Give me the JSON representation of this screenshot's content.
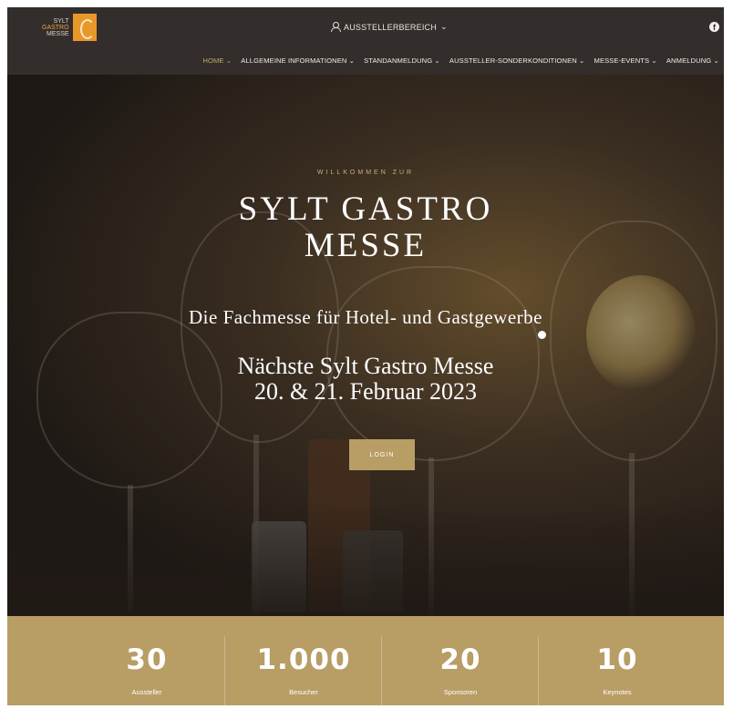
{
  "header": {
    "logo": {
      "line1": "SYLT",
      "line2": "GASTRO",
      "line3": "MESSE",
      "accent": "#e8972b"
    },
    "aussteller_link": "AUSSTELLERBEREICH",
    "social_icon": "facebook-icon"
  },
  "nav": {
    "items": [
      {
        "label": "HOME ⌄",
        "active": true
      },
      {
        "label": "ALLGEMEINE INFORMATIONEN ⌄"
      },
      {
        "label": "STANDANMELDUNG ⌄"
      },
      {
        "label": "AUSSTELLER-SONDERKONDITIONEN ⌄"
      },
      {
        "label": "MESSE-EVENTS ⌄"
      },
      {
        "label": "ANMELDUNG ⌄"
      }
    ]
  },
  "hero": {
    "welcome": "WILLKOMMEN ZUR",
    "title_line1": "SYLT GASTRO",
    "title_line2": "MESSE",
    "subtitle": "Die Fachmesse für Hotel- und Gastgewerbe",
    "next_line1": "Nächste Sylt Gastro Messe",
    "next_line2": "20. & 21. Februar 2023",
    "button": "LOGIN"
  },
  "stats": [
    {
      "number": "30",
      "label": "Aussteller"
    },
    {
      "number": "1.000",
      "label": "Besucher"
    },
    {
      "number": "20",
      "label": "Sponsoren"
    },
    {
      "number": "10",
      "label": "Keynotes"
    }
  ],
  "colors": {
    "header_bg": "#332e2b",
    "gold": "#b89d65",
    "nav_active": "#c7a869"
  }
}
